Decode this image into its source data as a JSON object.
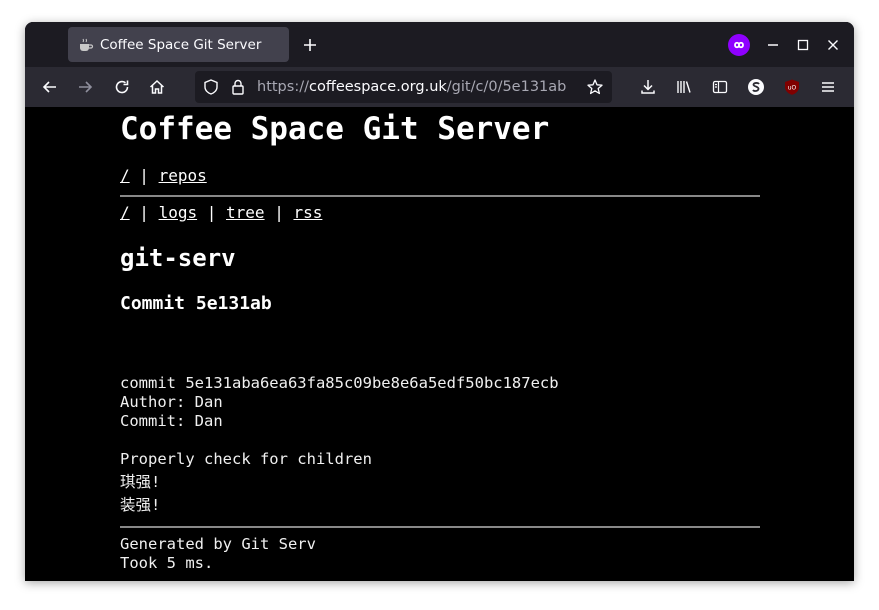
{
  "browser": {
    "tab_title": "Coffee Space Git Server",
    "url_scheme": "https://",
    "url_domain": "coffeespace.org.uk",
    "url_path": "/git/c/0/5e131ab"
  },
  "colors": {
    "tab_bar": "#1c1b22",
    "nav_bar": "#2b2a33",
    "active_tab": "#42414d",
    "page_background": "#000000",
    "extension_purple": "#8f00ff",
    "ublock_red": "#800000"
  },
  "page": {
    "title": "Coffee Space Git Server",
    "top_nav": {
      "root_link": "/",
      "separator": "|",
      "repos_link": "repos"
    },
    "repo_nav": {
      "root_link": "/",
      "sep1": "|",
      "logs_link": "logs",
      "sep2": "|",
      "tree_link": "tree",
      "sep3": "|",
      "rss_link": "rss"
    },
    "repo_name": "git-serv",
    "commit_heading": "Commit 5e131ab",
    "commit_line": "commit 5e131aba6ea63fa85c09be8e6a5edf50bc187ecb",
    "author_line": "Author: Dan",
    "committer_line": "Commit: Dan",
    "message_line1": "Properly check for children",
    "message_line2": "琪强!",
    "message_line3": "装强!",
    "footer_line1": "Generated by Git Serv",
    "footer_line2": "Took 5 ms."
  }
}
